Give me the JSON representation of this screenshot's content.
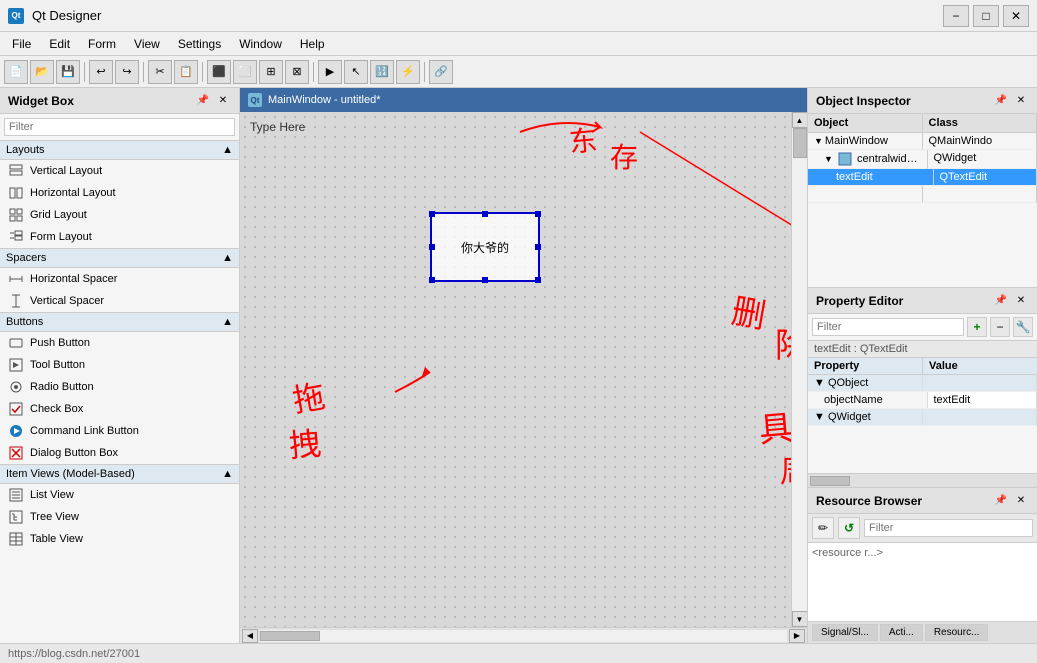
{
  "app": {
    "title": "Qt Designer",
    "icon_label": "Qt"
  },
  "title_controls": {
    "minimize": "−",
    "maximize": "□",
    "close": "✕"
  },
  "menu": {
    "items": [
      "File",
      "Edit",
      "Form",
      "View",
      "Settings",
      "Window",
      "Help"
    ]
  },
  "toolbar": {
    "buttons": [
      "📄",
      "📂",
      "💾",
      "",
      "⬜",
      "⬛",
      "",
      "✂",
      "📋",
      "",
      "🔲",
      "⬜",
      "",
      "▶",
      "⏹",
      "",
      "🔀",
      "↔",
      ""
    ]
  },
  "widget_box": {
    "title": "Widget Box",
    "filter_placeholder": "Filter",
    "sections": [
      {
        "name": "Layouts",
        "items": [
          {
            "icon": "≡",
            "label": "Vertical Layout"
          },
          {
            "icon": "⊟",
            "label": "Horizontal Layout"
          },
          {
            "icon": "⊞",
            "label": "Grid Layout"
          },
          {
            "icon": "⊠",
            "label": "Form Layout"
          }
        ]
      },
      {
        "name": "Spacers",
        "items": [
          {
            "icon": "↔",
            "label": "Horizontal Spacer"
          },
          {
            "icon": "↕",
            "label": "Vertical Spacer"
          }
        ]
      },
      {
        "name": "Buttons",
        "items": [
          {
            "icon": "⬜",
            "label": "Push Button"
          },
          {
            "icon": "🔧",
            "label": "Tool Button"
          },
          {
            "icon": "⊙",
            "label": "Radio Button"
          },
          {
            "icon": "☑",
            "label": "Check Box"
          },
          {
            "icon": "➡",
            "label": "Command Link Button"
          },
          {
            "icon": "✕",
            "label": "Dialog Button Box"
          }
        ]
      },
      {
        "name": "Item Views (Model-Based)",
        "items": [
          {
            "icon": "📋",
            "label": "List View"
          },
          {
            "icon": "🌲",
            "label": "Tree View"
          },
          {
            "icon": "⊞",
            "label": "Table View"
          }
        ]
      }
    ]
  },
  "canvas": {
    "title": "MainWindow - untitled*",
    "icon_label": "Qt",
    "type_here": "Type Here",
    "widget_text": "你大爷的",
    "scrollbar_left": "◀",
    "scrollbar_right": "▶"
  },
  "object_inspector": {
    "title": "Object Inspector",
    "columns": [
      "Object",
      "Class"
    ],
    "rows": [
      {
        "indent": 0,
        "arrow": "▼",
        "object": "MainWindow",
        "class": "QMainWindo"
      },
      {
        "indent": 1,
        "arrow": "▼",
        "object": "centralwidget",
        "class": "QWidget"
      },
      {
        "indent": 2,
        "arrow": "",
        "object": "textEdit",
        "class": "QTextEdit"
      },
      {
        "indent": 2,
        "arrow": "",
        "object": "",
        "class": ""
      }
    ]
  },
  "property_editor": {
    "title": "Property Editor",
    "filter_placeholder": "Filter",
    "add_btn": "+",
    "remove_btn": "−",
    "wrench_btn": "🔧",
    "subtitle": "textEdit : QTextEdit",
    "sections": [
      {
        "name": "QObject",
        "properties": [
          {
            "name": "objectName",
            "value": "textEdit"
          }
        ]
      },
      {
        "name": "QWidget",
        "properties": []
      }
    ]
  },
  "resource_browser": {
    "title": "Resource Browser",
    "filter_placeholder": "Filter",
    "pencil_btn": "✏",
    "refresh_btn": "↺",
    "content": "<resource r...>"
  },
  "bottom_tabs": [
    "Signal/Sl...",
    "Acti...",
    "Resourc..."
  ],
  "colors": {
    "accent_blue": "#3c6aa3",
    "selection": "#3399ff",
    "section_bg": "#dde8f0",
    "panel_header": "#e1e1e1"
  }
}
